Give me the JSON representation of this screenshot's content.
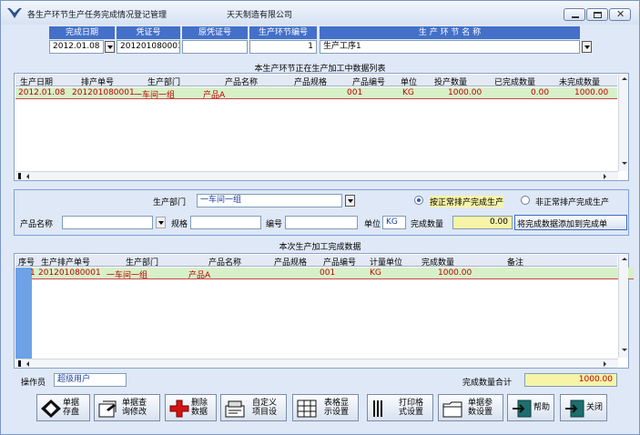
{
  "window": {
    "title": "各生产环节生产任务完成情况登记管理",
    "company": "天天制造有限公司",
    "buttons": [
      "minimize",
      "restore",
      "close"
    ]
  },
  "header": {
    "labels": {
      "date": "完成日期",
      "voucher": "凭证号",
      "original_voucher": "原凭证号",
      "stage_no": "生产环节编号",
      "stage_name": "生 产 环 节 名 称"
    },
    "values": {
      "date": "2012.01.08",
      "voucher": "201201080001",
      "original_voucher": "",
      "stage_no": "1",
      "stage_name": "生产工序1"
    }
  },
  "wip_table": {
    "title": "本生产环节正在生产加工中数据列表",
    "columns": [
      "生产日期",
      "排产单号",
      "生产部门",
      "产品名称",
      "产品规格",
      "产品编号",
      "单位",
      "投产数量",
      "已完成数量",
      "未完成数量"
    ],
    "rows": [
      [
        "2012.01.08",
        "201201080001",
        "一车间一组",
        "产品A",
        "",
        "001",
        "KG",
        "1000.00",
        "0.00",
        "1000.00"
      ]
    ]
  },
  "form": {
    "dept_label": "生产部门",
    "dept_value": "一车间一组",
    "radio_normal": "按正常排产完成生产",
    "radio_abnormal": "非正常排产完成生产",
    "radio_selected": "normal",
    "product_label": "产品名称",
    "product_value": "",
    "spec_label": "规格",
    "spec_value": "",
    "code_label": "编号",
    "code_value": "",
    "unit_label": "单位",
    "unit_value": "KG",
    "qty_label": "完成数量",
    "qty_value": "0.00",
    "add_button": "将完成数据添加到完成单"
  },
  "done_table": {
    "title": "本次生产加工完成数据",
    "columns": [
      "序号",
      "生产排产单号",
      "生产部门",
      "产品名称",
      "产品规格",
      "产品编号",
      "计量单位",
      "完成数量",
      "备注"
    ],
    "rows": [
      [
        "1",
        "201201080001",
        "一车间一组",
        "产品A",
        "",
        "001",
        "KG",
        "1000.00",
        ""
      ]
    ]
  },
  "footer": {
    "operator_label": "操作员",
    "operator_value": "超级用户",
    "total_label": "完成数量合计",
    "total_value": "1000.00"
  },
  "toolbar": [
    {
      "label": "单据\n存盘",
      "icon": "save-diamond-icon"
    },
    {
      "label": "单据查\n询修改",
      "icon": "query-edit-icon"
    },
    {
      "label": "删除\n数据",
      "icon": "delete-cross-icon"
    },
    {
      "label": "自定义\n项目设",
      "icon": "custom-items-icon"
    },
    {
      "label": "表格显\n示设置",
      "icon": "table-display-icon"
    },
    {
      "label": "打印格\n式设置",
      "icon": "print-format-icon"
    },
    {
      "label": "单据参\n数设置",
      "icon": "doc-params-icon"
    },
    {
      "label": "帮助",
      "icon": "help-exit-icon"
    },
    {
      "label": "关闭",
      "icon": "close-exit-icon"
    }
  ],
  "colors": {
    "header_blue": "#4470c9",
    "row_highlight": "#d8f0c8",
    "row_text": "#c00000",
    "window_bg": "#dfe8f6"
  }
}
